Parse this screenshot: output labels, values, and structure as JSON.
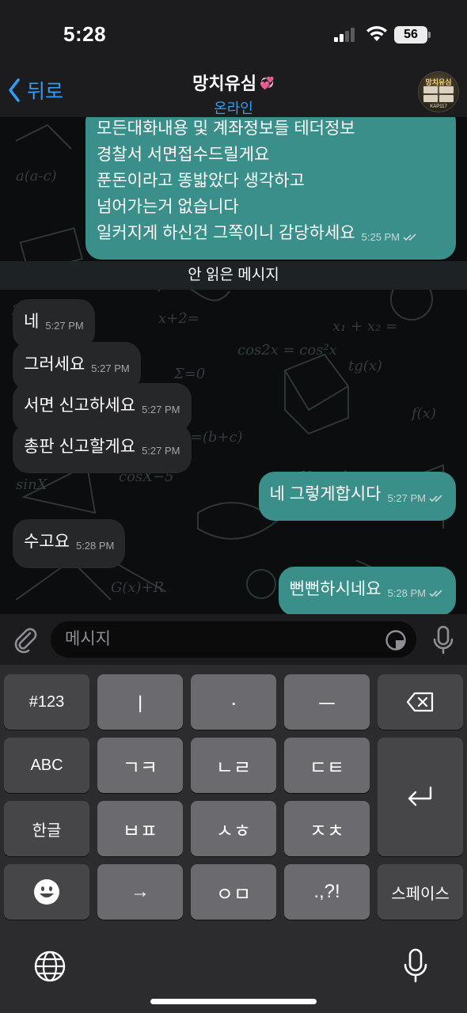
{
  "status_bar": {
    "time": "5:28",
    "battery": "56"
  },
  "header": {
    "back_label": "뒤로",
    "chat_title": "망치유심",
    "presence": "온라인",
    "avatar_title": "망치유심",
    "avatar_caption": "KAP117"
  },
  "messages": {
    "long_outgoing": {
      "lines": [
        "모든대화내용 및 계좌정보들 테더정보",
        "경찰서 서면접수드릴게요",
        "푼돈이라고 똥밟았다 생각하고",
        "넘어가는거 없습니다",
        "일커지게 하신건 그쪽이니 감당하세요"
      ],
      "time": "5:25 PM"
    },
    "unread_divider": "안 읽은 메시지",
    "items": [
      {
        "text": "네",
        "time": "5:27 PM"
      },
      {
        "text": "그러세요",
        "time": "5:27 PM"
      },
      {
        "text": "서면 신고하세요",
        "time": "5:27 PM"
      },
      {
        "text": "총판 신고할게요",
        "time": "5:27 PM"
      },
      {
        "text": "네 그렇게합시다",
        "time": "5:27 PM"
      },
      {
        "text": "수고요",
        "time": "5:28 PM"
      },
      {
        "text": "뻔뻔하시네요",
        "time": "5:28 PM"
      }
    ]
  },
  "input": {
    "placeholder": "메시지"
  },
  "keyboard": {
    "row1": [
      "#123",
      "ㅣ",
      "ㆍ",
      "ㅡ"
    ],
    "row2": [
      "ABC",
      "ㄱㅋ",
      "ㄴㄹ",
      "ㄷㅌ"
    ],
    "row3": [
      "한글",
      "ㅂㅍ",
      "ㅅㅎ",
      "ㅈㅊ"
    ],
    "row4": [
      "→",
      "ㅇㅁ",
      ".,?!",
      "스페이스"
    ]
  },
  "colors": {
    "accent": "#2f9cf5",
    "outgoing_bubble": "#3b8f8a",
    "incoming_bubble": "#252729"
  }
}
